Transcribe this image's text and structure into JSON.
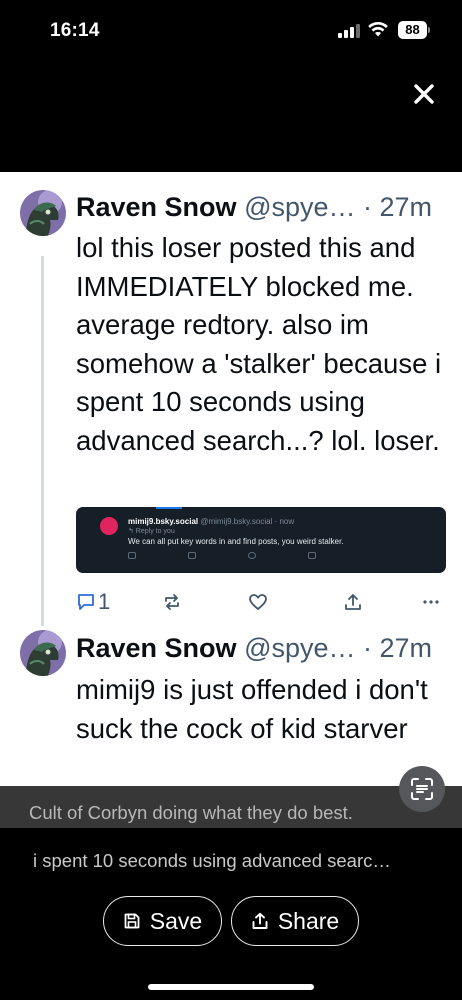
{
  "status_bar": {
    "time": "16:14",
    "battery": "88"
  },
  "thread": {
    "posts": [
      {
        "author": "Raven Snow",
        "handle": "@spye…",
        "time": "· 27m",
        "text": "lol this loser posted this and IMMEDIATELY blocked me. average redtory. also im somehow a 'stalker' because i spent 10 seconds using advanced search...? lol. loser.",
        "embed": {
          "author": "mimij9.bsky.social",
          "meta": "@mimij9.bsky.social · now",
          "reply_to": "↰ Reply to you",
          "text": "We can all put key words in and find posts, you weird stalker."
        },
        "reply_count": "1"
      },
      {
        "author": "Raven Snow",
        "handle": "@spye…",
        "time": "· 27m",
        "text": "mimij9 is just offended i don't suck the cock of kid starver"
      }
    ]
  },
  "overlay": {
    "caption": "Cult of Corbyn doing what they do best.",
    "alt_text": "i spent 10 seconds using advanced searc…",
    "save_label": "Save",
    "share_label": "Share"
  },
  "icons": {
    "close": "close-icon",
    "reply": "reply-icon",
    "repost": "repost-icon",
    "like": "heart-icon",
    "share": "share-icon",
    "more": "more-icon",
    "ocr": "text-scan-icon",
    "save": "save-icon"
  },
  "colors": {
    "accent_blue": "#1d79e6",
    "muted_text": "#42576c"
  }
}
